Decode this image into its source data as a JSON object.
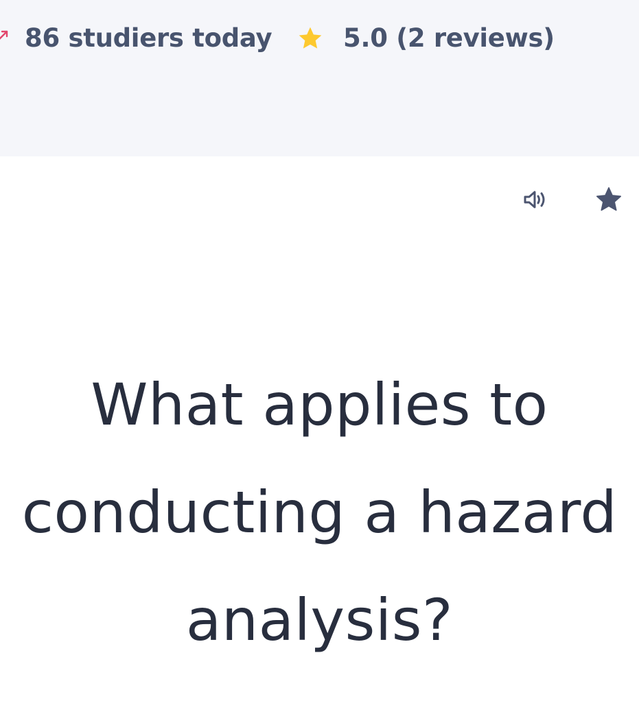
{
  "header": {
    "studiers_text": "86 studiers today",
    "rating_text": "5.0 (2 reviews)",
    "trend_icon": "trend-up-arrow-icon",
    "rating_icon": "star-icon"
  },
  "card": {
    "audio_icon": "speaker-icon",
    "favorite_icon": "star-icon",
    "question": "What applies to conducting a hazard analysis?"
  },
  "colors": {
    "header_bg": "#f5f6fa",
    "header_text": "#48546e",
    "trend_accent": "#e2456b",
    "rating_star": "#fdc92f",
    "icon_slate": "#4c5570",
    "question_text": "#282e3e"
  }
}
